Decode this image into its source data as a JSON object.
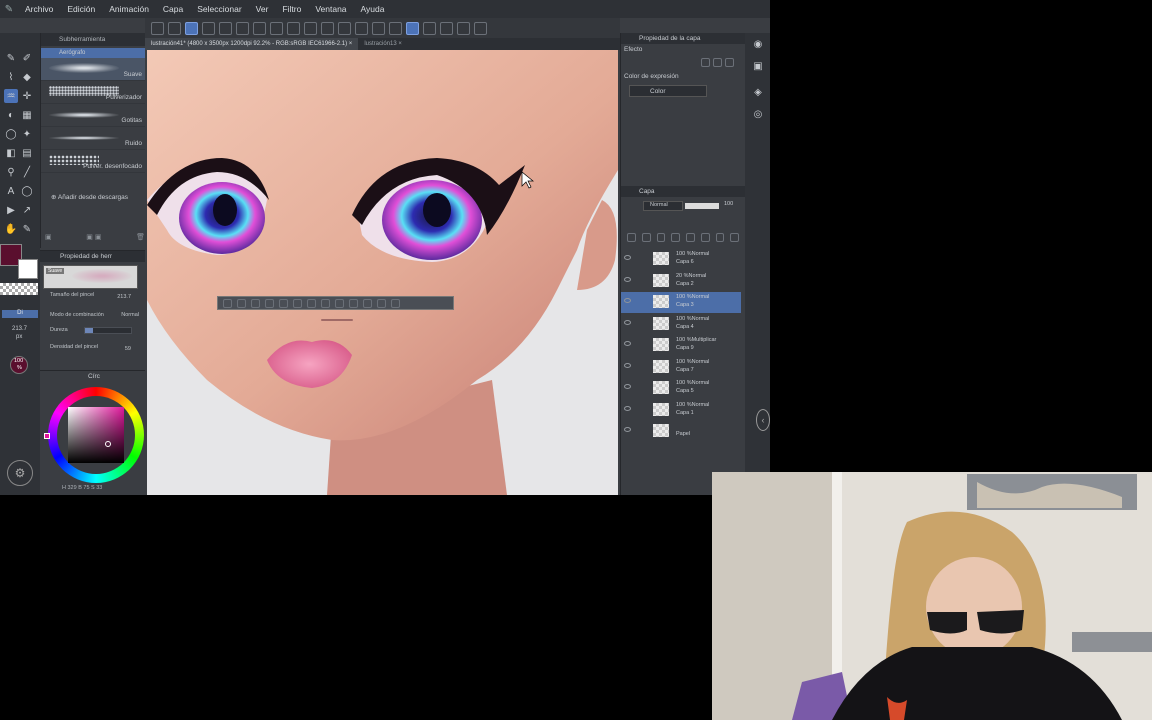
{
  "menu": {
    "items": [
      "Archivo",
      "Edición",
      "Animación",
      "Capa",
      "Seleccionar",
      "Ver",
      "Filtro",
      "Ventana",
      "Ayuda"
    ]
  },
  "tabs": {
    "active": "lustración41* (4800 x 3500px 1200dpi 92.2% - RGB:sRGB IEC61966-2.1)",
    "other": "lustración13"
  },
  "subtool": {
    "header": "Subherramienta",
    "group": "Aerógrafo",
    "brushes": [
      "Suave",
      "Pulverizador",
      "Gotitas",
      "Ruido",
      "Pulver. desenfocado"
    ],
    "add_download": "Añadir desde descargas"
  },
  "brush_props": {
    "header": "Propiedad de herr",
    "current": "Suave",
    "size_label": "Tamaño del pincel",
    "size_value": "213.7",
    "blend_label": "Modo de combinación",
    "blend_value": "Normal",
    "hardness_label": "Dureza",
    "density_label": "Densidad del pincel",
    "density_value": "59"
  },
  "left_readouts": {
    "size": "213.7",
    "size_unit": "px",
    "opacity": "100",
    "opacity_unit": "%",
    "color_panel": "Círc",
    "color_values": "H 329 B 75 S 33"
  },
  "right": {
    "layer_prop_header": "Propiedad de la capa",
    "effect_label": "Efecto",
    "expression_color_label": "Color de expresión",
    "expression_color_value": "Color",
    "layers_header": "Capa",
    "blend_mode": "Normal",
    "opacity": "100",
    "layers": [
      {
        "line1": "100 %Normal",
        "line2": "Capa 6",
        "selected": false
      },
      {
        "line1": "20 %Normal",
        "line2": "Capa 2",
        "selected": false
      },
      {
        "line1": "100 %Normal",
        "line2": "Capa 3",
        "selected": true
      },
      {
        "line1": "100 %Normal",
        "line2": "Capa 4",
        "selected": false
      },
      {
        "line1": "100 %Multiplicar",
        "line2": "Capa 9",
        "selected": false
      },
      {
        "line1": "100 %Normal",
        "line2": "Capa 7",
        "selected": false
      },
      {
        "line1": "100 %Normal",
        "line2": "Capa 5",
        "selected": false
      },
      {
        "line1": "100 %Normal",
        "line2": "Capa 1",
        "selected": false
      },
      {
        "line1": "",
        "line2": "Papel",
        "selected": false
      }
    ]
  },
  "colors": {
    "main": "#5a0f2e",
    "sub": "#ffffff",
    "accent": "#4c73b8",
    "iris_magenta": "#e14fd8",
    "lip_pink": "#e0638f"
  }
}
